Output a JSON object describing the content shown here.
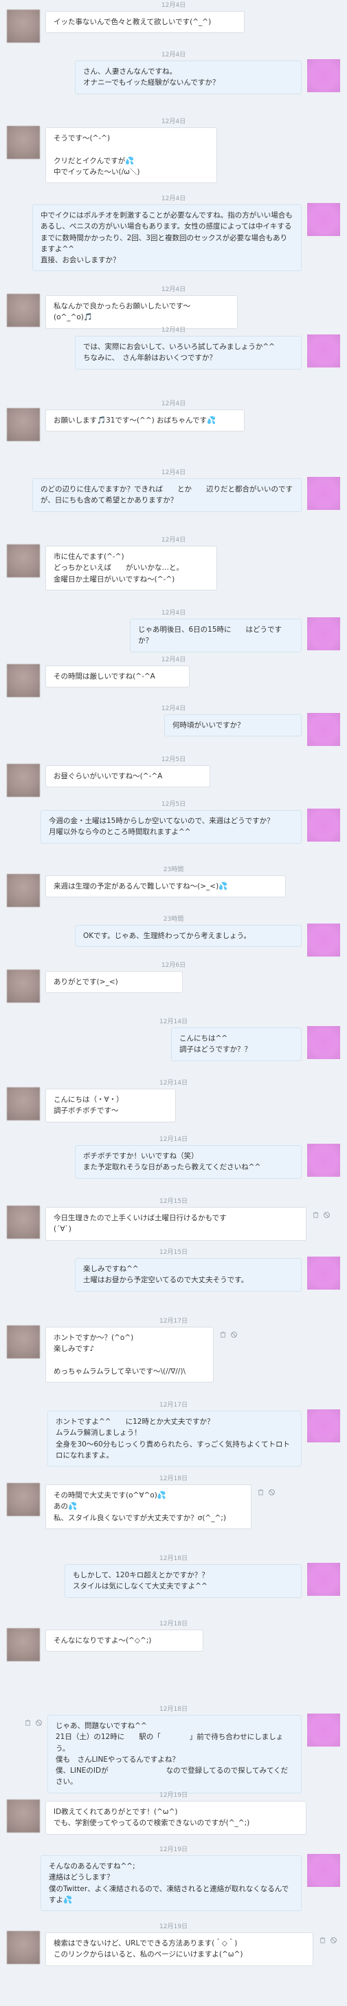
{
  "messages": [
    {
      "side": "left",
      "time": "12月4日",
      "text": "イッた事ないんで色々と教えて欲しいです(^_^)"
    },
    {
      "side": "right",
      "time": "12月4日",
      "text": "さん、人妻さんなんですね。\nオナニーでもイッた経験がないんですか？"
    },
    {
      "side": "left",
      "time": "12月4日",
      "text": "そうです〜(^-^)\n\nクリだとイクんですが💦\n中でイッてみた〜い(/ω＼)"
    },
    {
      "side": "right",
      "time": "12月4日",
      "text": "中でイクにはポルチオを刺激することが必要なんですね。指の方がいい場合もあるし、ペニスの方がいい場合もあります。女性の感度によっては中イキするまでに数時間かかったり、2回、3回と複数回のセックスが必要な場合もありますよ^^\n直接、お会いしますか？"
    },
    {
      "side": "left",
      "time": "12月4日",
      "text": "私なんかで良かったらお願いしたいです〜(o^_^o)🎵"
    },
    {
      "side": "right",
      "time": "12月4日",
      "text": "では、実際にお会いして、いろいろ試してみましょうか^^\nちなみに、　さん年齢はおいくつですか？"
    },
    {
      "side": "left",
      "time": "12月4日",
      "text": "お願いします🎵31です〜(^^) おばちゃんです💦"
    },
    {
      "side": "right",
      "time": "12月4日",
      "text": "のどの辺りに住んでますか？できれば　　とか　　辺りだと都合がいいのですが、日にちも含めて希望とかありますか？"
    },
    {
      "side": "left",
      "time": "12月4日",
      "text": "市に住んでます(^-^)\nどっちかといえば　　がいいかな…と。\n金曜日か土曜日がいいですね〜(^-^)"
    },
    {
      "side": "right",
      "time": "12月4日",
      "text": "じゃあ明後日、6日の15時に　　はどうですか？"
    },
    {
      "side": "left",
      "time": "12月4日",
      "text": "その時間は厳しいですね(^-^A"
    },
    {
      "side": "right",
      "time": "12月4日",
      "text": "何時頃がいいですか？"
    },
    {
      "side": "left",
      "time": "12月5日",
      "text": "お昼ぐらいがいいですね〜(^-^A"
    },
    {
      "side": "right",
      "time": "12月5日",
      "text": "今週の金・土曜は15時からしか空いてないので、来週はどうですか？\n月曜以外なら今のところ時間取れますよ^^"
    },
    {
      "side": "left",
      "time": "23時間",
      "text": "来週は生理の予定があるんで難しいですね〜(>_<)💦"
    },
    {
      "side": "right",
      "time": "23時間",
      "text": "OKです。じゃあ、生理終わってから考えましょう。"
    },
    {
      "side": "left",
      "time": "12月6日",
      "text": "ありがとです(>_<)"
    },
    {
      "side": "right",
      "time": "12月14日",
      "text": "こんにちは^^\n調子はどうですか？？"
    },
    {
      "side": "left",
      "time": "12月14日",
      "text": "こんにちは（・∀・）\n調子ボチボチです〜"
    },
    {
      "side": "right",
      "time": "12月14日",
      "text": "ボチボチですか！いいですね（笑）\nまた予定取れそうな日があったら教えてくださいね^^"
    },
    {
      "side": "left",
      "time": "12月15日",
      "text": "今日生理きたので上手くいけば土曜日行けるかもです\n(´∀`)"
    },
    {
      "side": "right",
      "time": "12月15日",
      "text": "楽しみですね^^\n土曜はお昼から予定空いてるので大丈夫そうです。"
    },
    {
      "side": "left",
      "time": "12月17日",
      "text": "ホントですか〜？(^o^)\n楽しみです♪\n\nめっちゃムラムラして辛いです〜\\(//∇//)\\"
    },
    {
      "side": "right",
      "time": "12月17日",
      "text": "ホントですよ^^　　に12時とか大丈夫ですか？\nムラムラ解消しましょう！\n全身を30〜60分もじっくり責められたら、すっごく気持ちよくてトロトロになれますよ。"
    },
    {
      "side": "left",
      "time": "12月18日",
      "text": "その時間で大丈夫です(o^∀^o)💦\nあの💦\n私、スタイル良くないですが大丈夫ですか？σ(^_^;)"
    },
    {
      "side": "right",
      "time": "12月18日",
      "text": "もしかして、120キロ超えとかですか？？\nスタイルは気にしなくて大丈夫ですよ^^"
    },
    {
      "side": "left",
      "time": "12月18日",
      "text": "そんなになりですよ〜(^◇^;)"
    },
    {
      "side": "right",
      "time": "12月18日",
      "text": "じゃあ、問題ないですね^^\n21日（土）の12時に　　駅の「　　　　」前で待ち合わせにしましょう。\n僕も　さんLINEやってるんですよね？\n僕、LINEのIDが　　　　　　　　なので登録してるので探してみてください。"
    },
    {
      "side": "left",
      "time": "12月19日",
      "text": "ID教えてくれてありがとです！(^ω^)\nでも、学割使ってやってるので検索できないのですが(^_^;)"
    },
    {
      "side": "right",
      "time": "12月19日",
      "text": "そんなのあるんですね^^;\n連絡はどうします？\n僕のTwitter、よく凍結されるので、凍結されると連絡が取れなくなるんですよ💦"
    },
    {
      "side": "left",
      "time": "12月19日",
      "text": "検索はできないけど、URLでできる方法あります(＾◇＾)\nこのリンクからはいると、私のページにいけますよ(^ω^)"
    }
  ]
}
